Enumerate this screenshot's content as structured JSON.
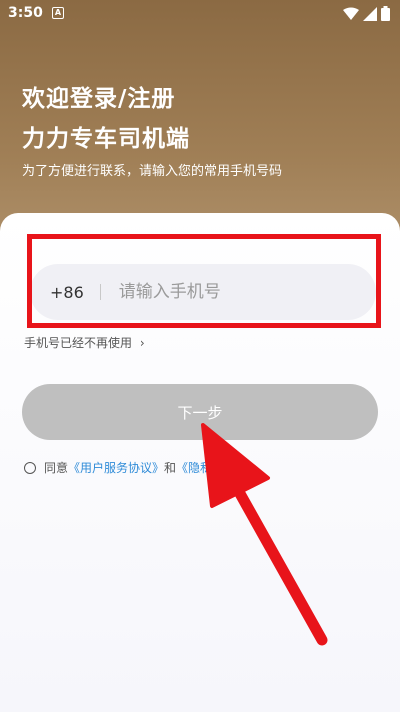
{
  "status_bar": {
    "time": "3:50",
    "a_badge": "A"
  },
  "header": {
    "title_line1": "欢迎登录/注册",
    "title_line2": "力力专车司机端",
    "subtitle": "为了方便进行联系，请输入您的常用手机号码"
  },
  "form": {
    "country_code": "+86",
    "phone_placeholder": "请输入手机号",
    "phone_disused_label": "手机号已经不再使用",
    "phone_disused_chevron": "›",
    "next_label": "下一步"
  },
  "agreement": {
    "prefix": "同意",
    "user_agreement": "《用户服务协议》",
    "and": "和",
    "privacy_link": "《隐私政策》"
  },
  "colors": {
    "header_brown": "#8b6a43",
    "link_blue": "#2f8bd8",
    "annotation_red": "#e8141a",
    "button_disabled": "#bfbfbf"
  }
}
